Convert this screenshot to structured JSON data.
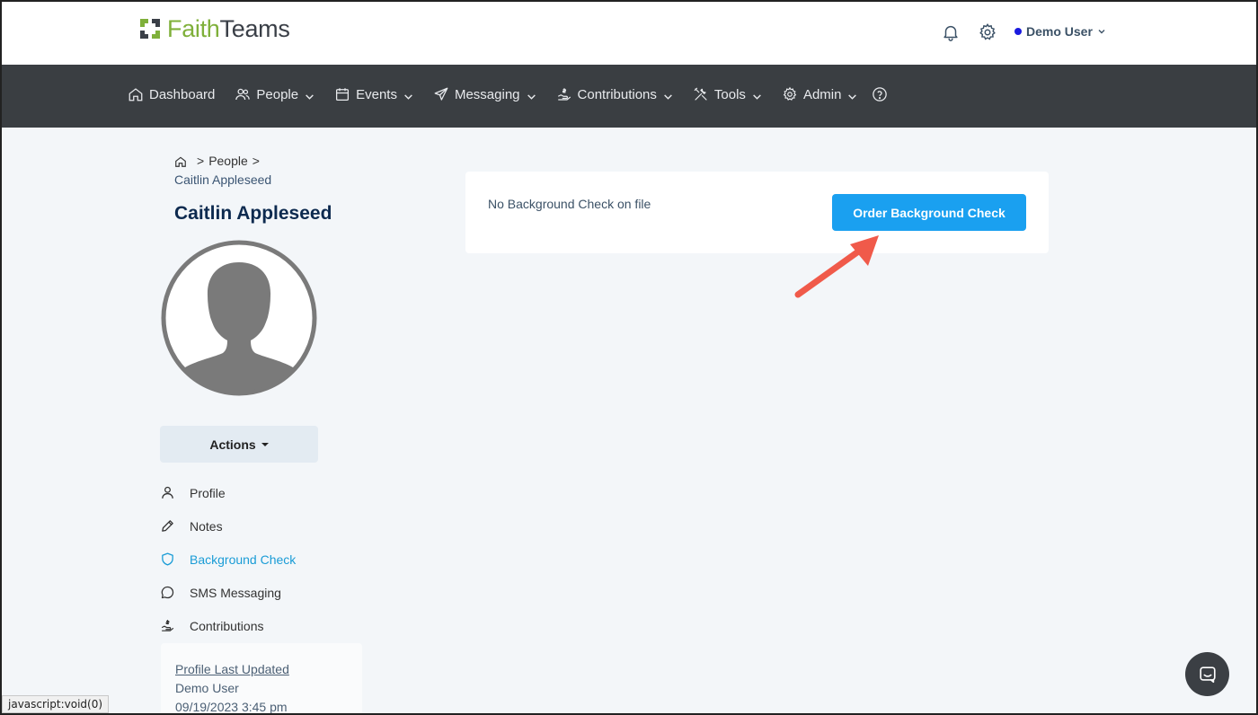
{
  "brand": {
    "logo_part1": "Faith",
    "logo_part2": "Teams",
    "accent": "#7fb03a"
  },
  "header": {
    "notifications_icon": "bell-icon",
    "settings_icon": "gear-icon",
    "user_name": "Demo User",
    "status_color": "#1a1adf"
  },
  "nav": {
    "items": [
      {
        "label": "Dashboard",
        "icon": "home-icon",
        "dropdown": false
      },
      {
        "label": "People",
        "icon": "people-icon",
        "dropdown": true
      },
      {
        "label": "Events",
        "icon": "calendar-icon",
        "dropdown": true
      },
      {
        "label": "Messaging",
        "icon": "paper-plane-icon",
        "dropdown": true
      },
      {
        "label": "Contributions",
        "icon": "hand-dollar-icon",
        "dropdown": true
      },
      {
        "label": "Tools",
        "icon": "tools-icon",
        "dropdown": true
      },
      {
        "label": "Admin",
        "icon": "gear-icon",
        "dropdown": true
      }
    ],
    "help_icon": "question-circle-icon"
  },
  "breadcrumb": {
    "sep": ">",
    "people": "People",
    "current": "Caitlin Appleseed"
  },
  "person": {
    "name": "Caitlin Appleseed"
  },
  "actions": {
    "label": "Actions"
  },
  "side_menu": [
    {
      "label": "Profile",
      "icon": "user-icon",
      "active": false
    },
    {
      "label": "Notes",
      "icon": "pencil-icon",
      "active": false
    },
    {
      "label": "Background Check",
      "icon": "shield-icon",
      "active": true
    },
    {
      "label": "SMS Messaging",
      "icon": "chat-icon",
      "active": false
    },
    {
      "label": "Contributions",
      "icon": "hand-dollar-icon",
      "active": false
    }
  ],
  "profile_updated": {
    "label": "Profile Last Updated",
    "by": "Demo User",
    "when": "09/19/2023 3:45 pm"
  },
  "background_check": {
    "status_text": "No Background Check on file",
    "order_button": "Order Background Check",
    "button_color": "#1aa0f0"
  },
  "statusbar": {
    "text": "javascript:void(0)"
  }
}
